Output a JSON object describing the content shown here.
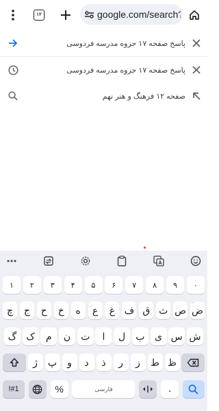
{
  "browser": {
    "tab_count": "۱۲",
    "url": "google.com/search?"
  },
  "suggestions": [
    {
      "text": "پاسخ صفحه ۱۷ جزوه مدرسه فردوسی",
      "icon": "arrow-right-icon",
      "action_icon": "close-icon"
    },
    {
      "text": "پاسخ صفحه ۱۷ جزوه مدرسه فردوسی",
      "icon": "history-icon",
      "action_icon": "close-icon"
    },
    {
      "text": "صفحه ۱۲ فرهنگ و هنر نهم",
      "icon": "search-icon",
      "action_icon": "arrow-up-left-icon"
    }
  ],
  "keyboard": {
    "toolbar": [
      "more-icon",
      "clipboard-swap-icon",
      "settings-icon",
      "clipboard-icon",
      "translate-icon",
      "emoji-icon"
    ],
    "number_row": [
      "۱",
      "۲",
      "۳",
      "۴",
      "۵",
      "۶",
      "۷",
      "۸",
      "۹",
      "۰"
    ],
    "row1": [
      "ض",
      "ص",
      "ث",
      "ق",
      "ف",
      "غ",
      "ع",
      "ه",
      "خ",
      "ح",
      "ج",
      "چ"
    ],
    "row1_hints": [
      "ّ",
      "",
      "",
      "",
      "",
      "",
      "ٍ",
      "",
      "",
      "",
      "",
      ""
    ],
    "row2": [
      "ش",
      "س",
      "ی",
      "ب",
      "ل",
      "ا",
      "ت",
      "ن",
      "م",
      "ک",
      "گ"
    ],
    "row2_hints": [
      "",
      "",
      "",
      "",
      "",
      "",
      "",
      "",
      "",
      "",
      ""
    ],
    "row3": [
      "ظ",
      "ط",
      "ز",
      "ر",
      "ذ",
      "د",
      "و",
      "پ",
      "ژ"
    ],
    "row3_hints": [
      "",
      "",
      "",
      "",
      "",
      "",
      "",
      "",
      ""
    ],
    "symbols_label": "!#1",
    "comma_label": "%",
    "space_label": "فارسی",
    "period_label": "."
  },
  "colors": {
    "keyboard_bg": "#eef0f5",
    "url_bg": "#edf0f6",
    "accent_blue": "#1a73e8"
  }
}
